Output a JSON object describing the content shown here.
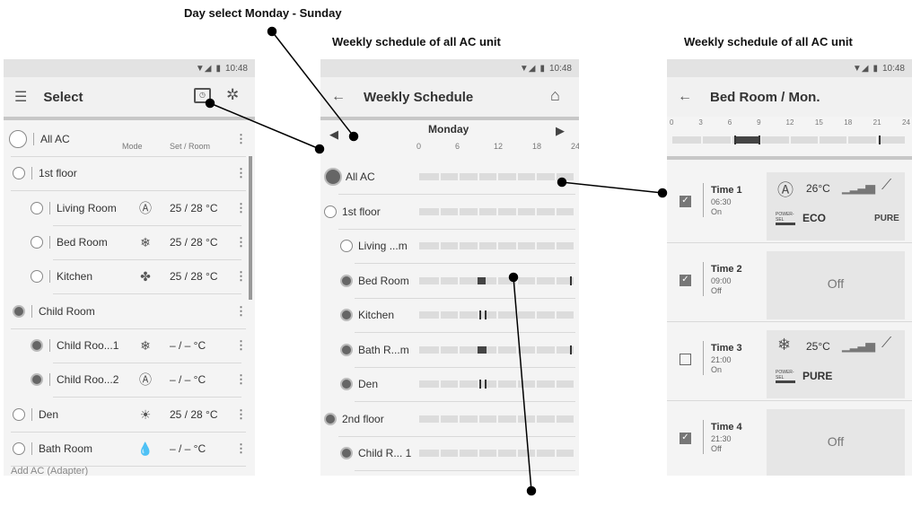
{
  "annotations": {
    "day_select": "Day select Monday - Sunday",
    "weekly_schedule_1": "Weekly schedule of all AC unit",
    "weekly_schedule_2": "Weekly schedule of all AC unit"
  },
  "status": {
    "time": "10:48"
  },
  "select_screen": {
    "title": "Select",
    "header_mode": "Mode",
    "header_set_room": "Set / Room",
    "items": [
      {
        "label": "All AC"
      },
      {
        "label": "1st floor"
      },
      {
        "label": "Living Room",
        "icon": "auto-mode-icon",
        "glyph": "Ⓐ",
        "temp": "25 / 28 °C"
      },
      {
        "label": "Bed Room",
        "icon": "cool-mode-icon",
        "glyph": "❄",
        "temp": "25 / 28 °C"
      },
      {
        "label": "Kitchen",
        "icon": "fan-mode-icon",
        "glyph": "✤",
        "temp": "25 / 28 °C"
      },
      {
        "label": "Child Room"
      },
      {
        "label": "Child Roo...1",
        "icon": "cool-mode-icon",
        "glyph": "❄",
        "temp": "– / –  °C"
      },
      {
        "label": "Child Roo...2",
        "icon": "auto-mode-icon",
        "glyph": "Ⓐ",
        "temp": "– / –  °C"
      },
      {
        "label": "Den",
        "icon": "heat-mode-icon",
        "glyph": "☀",
        "temp": "25 / 28 °C"
      },
      {
        "label": "Bath Room",
        "icon": "dry-mode-icon",
        "glyph": "💧",
        "temp": "– / –  °C"
      },
      {
        "label": "Add AC (Adapter)"
      }
    ]
  },
  "weekly_screen": {
    "title": "Weekly Schedule",
    "day": "Monday",
    "hours": [
      "0",
      "6",
      "12",
      "18",
      "24"
    ],
    "rows": [
      {
        "label": "All AC"
      },
      {
        "label": "1st floor"
      },
      {
        "label": "Living ...m"
      },
      {
        "label": "Bed Room"
      },
      {
        "label": "Kitchen"
      },
      {
        "label": "Bath R...m"
      },
      {
        "label": "Den"
      },
      {
        "label": "2nd floor"
      },
      {
        "label": "Child R... 1"
      },
      {
        "label": "Child R... 2"
      }
    ]
  },
  "detail_screen": {
    "title": "Bed Room / Mon.",
    "hours": [
      "0",
      "3",
      "6",
      "9",
      "12",
      "15",
      "18",
      "21",
      "24"
    ],
    "times": [
      {
        "name": "Time 1",
        "time": "06:30",
        "state": "On",
        "checked": true,
        "temp": "26°C",
        "mode": "auto-mode-icon",
        "glyph": "Ⓐ",
        "badge": "POWER-SEL",
        "setting": "ECO",
        "purity": "PURE"
      },
      {
        "name": "Time 2",
        "time": "09:00",
        "state": "Off",
        "checked": true,
        "card_text": "Off"
      },
      {
        "name": "Time 3",
        "time": "21:00",
        "state": "On",
        "checked": false,
        "temp": "25°C",
        "mode": "cool-mode-icon",
        "glyph": "❄",
        "badge": "POWER-SEL",
        "setting": "PURE"
      },
      {
        "name": "Time 4",
        "time": "21:30",
        "state": "Off",
        "checked": true,
        "card_text": "Off"
      }
    ]
  }
}
